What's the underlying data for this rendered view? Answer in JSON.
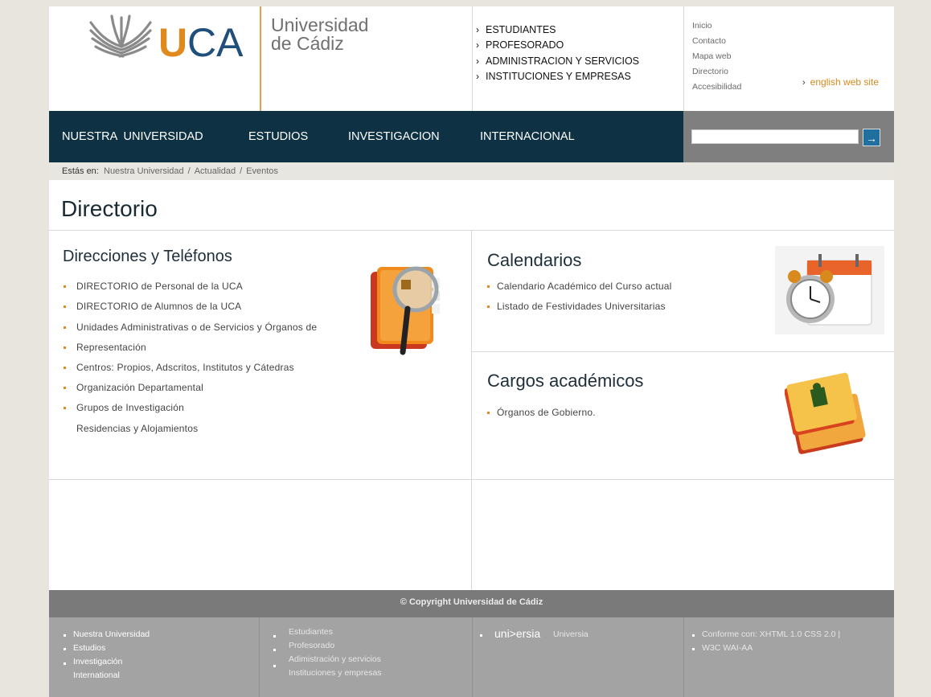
{
  "header": {
    "logo": {
      "mark": "UCA",
      "line1": "Universidad",
      "line2": "de Cádiz"
    },
    "audience": [
      "ESTUDIANTES",
      "PROFESORADO",
      "ADMINISTRACION Y SERVICIOS",
      "INSTITUCIONES Y EMPRESAS"
    ],
    "quick_links": [
      "Inicio",
      "Contacto",
      "Mapa web",
      "Directorio",
      "Accesibilidad"
    ],
    "english": "english web site"
  },
  "nav": [
    "NUESTRA  UNIVERSIDAD",
    "ESTUDIOS",
    "INVESTIGACION",
    "INTERNACIONAL"
  ],
  "search": {
    "button": "→",
    "value": ""
  },
  "breadcrumb": {
    "label": "Estás en:",
    "items": [
      "Nuestra Universidad",
      "Actualidad",
      "Eventos"
    ],
    "separator": "/"
  },
  "page_title": "Directorio",
  "sections": {
    "direcciones": {
      "title": "Direcciones y Teléfonos",
      "items": [
        "DIRECTORIO de Personal de la UCA",
        "DIRECTORIO de Alumnos de la UCA",
        "Unidades Administrativas o de Servicios y Órganos de",
        "Representación",
        "Centros: Propios, Adscritos, Institutos y Cátedras",
        "Organización Departamental",
        "Grupos de Investigación",
        "Residencias y Alojamientos"
      ]
    },
    "calendarios": {
      "title": "Calendarios",
      "items": [
        "Calendario Académico del Curso actual",
        "Listado de Festividades Universitarias"
      ]
    },
    "cargos": {
      "title": "Cargos académicos",
      "items": [
        "Órganos de Gobierno."
      ]
    }
  },
  "footer": {
    "copyright": "© Copyright Universidad de Cádiz",
    "col1": [
      "Nuestra Universidad",
      "Estudios",
      "Investigación",
      "International"
    ],
    "col2": [
      "Estudiantes",
      "Profesorado",
      "Adimistración y servicios",
      "Instituciones y empresas"
    ],
    "col3": {
      "logo": "uni>ersia",
      "text": "Universia"
    },
    "col4": [
      "Conforme con: XHTML 1.0  CSS 2.0 |",
      "W3C  WAI-AA"
    ]
  },
  "colors": {
    "navy": "#0e3243",
    "orange": "#e08a1d",
    "footer_dark": "#7a7a7a",
    "footer_light": "#a3a3a3"
  }
}
